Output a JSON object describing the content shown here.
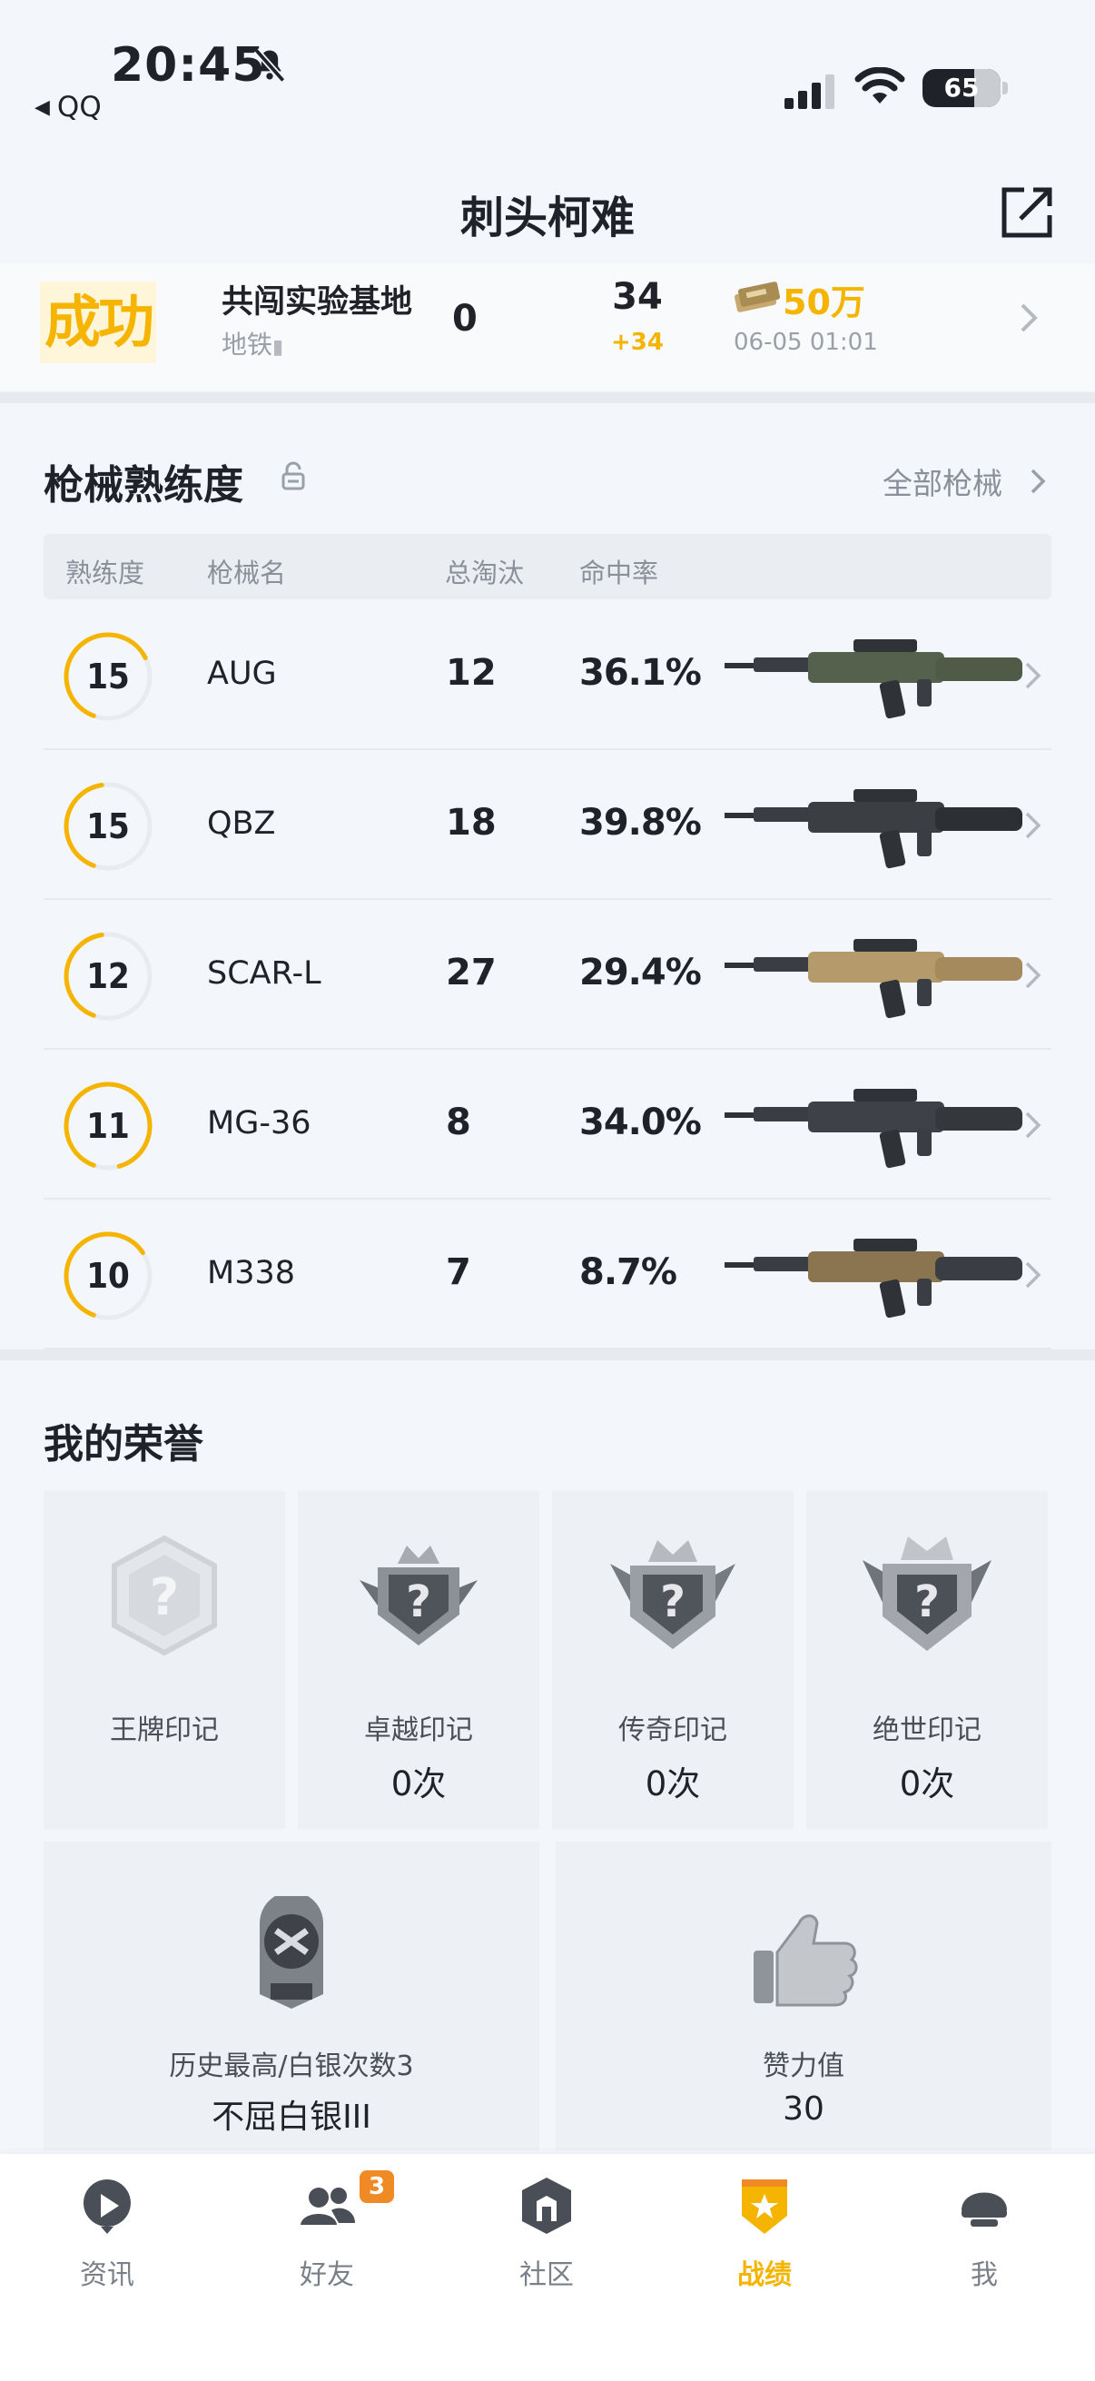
{
  "status_bar": {
    "time": "20:45",
    "back_app": "QQ",
    "battery": "65"
  },
  "header": {
    "title": "刺头柯难"
  },
  "match": {
    "result": "成功",
    "map": "共闯实验基地",
    "mode": "地铁",
    "kills": "0",
    "score": "34",
    "score_delta": "+34",
    "money": "50万",
    "date": "06-05 01:01"
  },
  "weapons": {
    "title": "枪械熟练度",
    "all_label": "全部枪械",
    "columns": [
      "熟练度",
      "枪械名",
      "总淘汰",
      "命中率"
    ],
    "rows": [
      {
        "level": "15",
        "progress": 0.62,
        "name": "AUG",
        "kills": "12",
        "accuracy": "36.1%"
      },
      {
        "level": "15",
        "progress": 0.42,
        "name": "QBZ",
        "kills": "18",
        "accuracy": "39.8%"
      },
      {
        "level": "12",
        "progress": 0.42,
        "name": "SCAR-L",
        "kills": "27",
        "accuracy": "29.4%"
      },
      {
        "level": "11",
        "progress": 0.9,
        "name": "MG-36",
        "kills": "8",
        "accuracy": "34.0%"
      },
      {
        "level": "10",
        "progress": 0.6,
        "name": "M338",
        "kills": "7",
        "accuracy": "8.7%"
      }
    ]
  },
  "honors": {
    "title": "我的荣誉",
    "marks": [
      {
        "label": "王牌印记",
        "count": ""
      },
      {
        "label": "卓越印记",
        "count": "0次"
      },
      {
        "label": "传奇印记",
        "count": "0次"
      },
      {
        "label": "绝世印记",
        "count": "0次"
      }
    ],
    "rank": {
      "label": "历史最高/白银次数3",
      "value": "不屈白银III"
    },
    "likes": {
      "label": "赞力值",
      "value": "30"
    }
  },
  "tabs": [
    {
      "label": "资讯"
    },
    {
      "label": "好友",
      "badge": "3"
    },
    {
      "label": "社区"
    },
    {
      "label": "战绩"
    },
    {
      "label": "我"
    }
  ],
  "colors": {
    "accent": "#f5b400",
    "background": "#f3f6fa"
  }
}
